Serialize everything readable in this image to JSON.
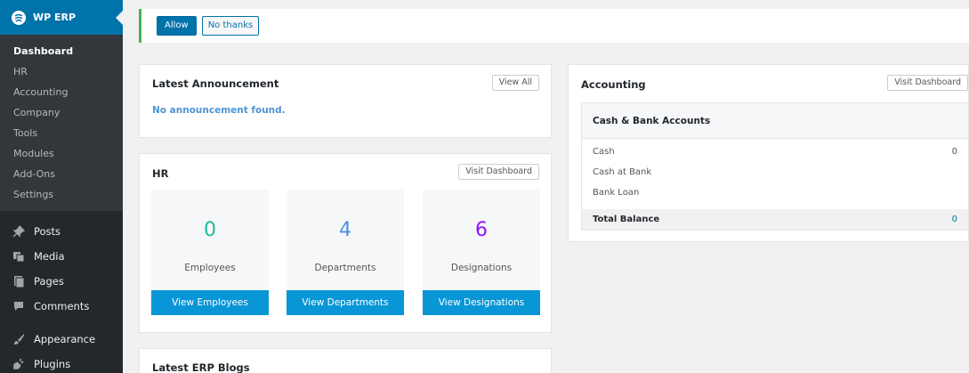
{
  "sidebar": {
    "header_title": "WP ERP",
    "submenu": [
      "Dashboard",
      "HR",
      "Accounting",
      "Company",
      "Tools",
      "Modules",
      "Add-Ons",
      "Settings"
    ],
    "active_submenu": "Dashboard",
    "menu_a": [
      {
        "label": "Posts",
        "icon": "pushpin-icon"
      },
      {
        "label": "Media",
        "icon": "media-icon"
      },
      {
        "label": "Pages",
        "icon": "pages-icon"
      },
      {
        "label": "Comments",
        "icon": "comment-icon"
      }
    ],
    "menu_b": [
      {
        "label": "Appearance",
        "icon": "brush-icon"
      },
      {
        "label": "Plugins",
        "icon": "plug-icon"
      }
    ]
  },
  "notice": {
    "allow_label": "Allow",
    "decline_label": "No thanks"
  },
  "announcement": {
    "title": "Latest Announcement",
    "view_all_label": "View All",
    "message": "No announcement found."
  },
  "hr": {
    "title": "HR",
    "visit_label": "Visit Dashboard",
    "stats": [
      {
        "value": "0",
        "label": "Employees",
        "action": "View Employees",
        "color": "#1abc9c"
      },
      {
        "value": "4",
        "label": "Departments",
        "action": "View Departments",
        "color": "#4a90e2"
      },
      {
        "value": "6",
        "label": "Designations",
        "action": "View Designations",
        "color": "#9013fe"
      }
    ]
  },
  "blogs": {
    "title": "Latest ERP Blogs"
  },
  "accounting": {
    "title": "Accounting",
    "visit_label": "Visit Dashboard",
    "table_title": "Cash & Bank Accounts",
    "rows": [
      {
        "name": "Cash",
        "value": "0"
      },
      {
        "name": "Cash at Bank",
        "value": ""
      },
      {
        "name": "Bank Loan",
        "value": ""
      }
    ],
    "total_label": "Total Balance",
    "total_value": "0"
  },
  "colors": {
    "wp_blue": "#0073aa",
    "action_blue": "#0996d6",
    "notice_green": "#46b450",
    "sidebar_dark": "#23282d"
  }
}
